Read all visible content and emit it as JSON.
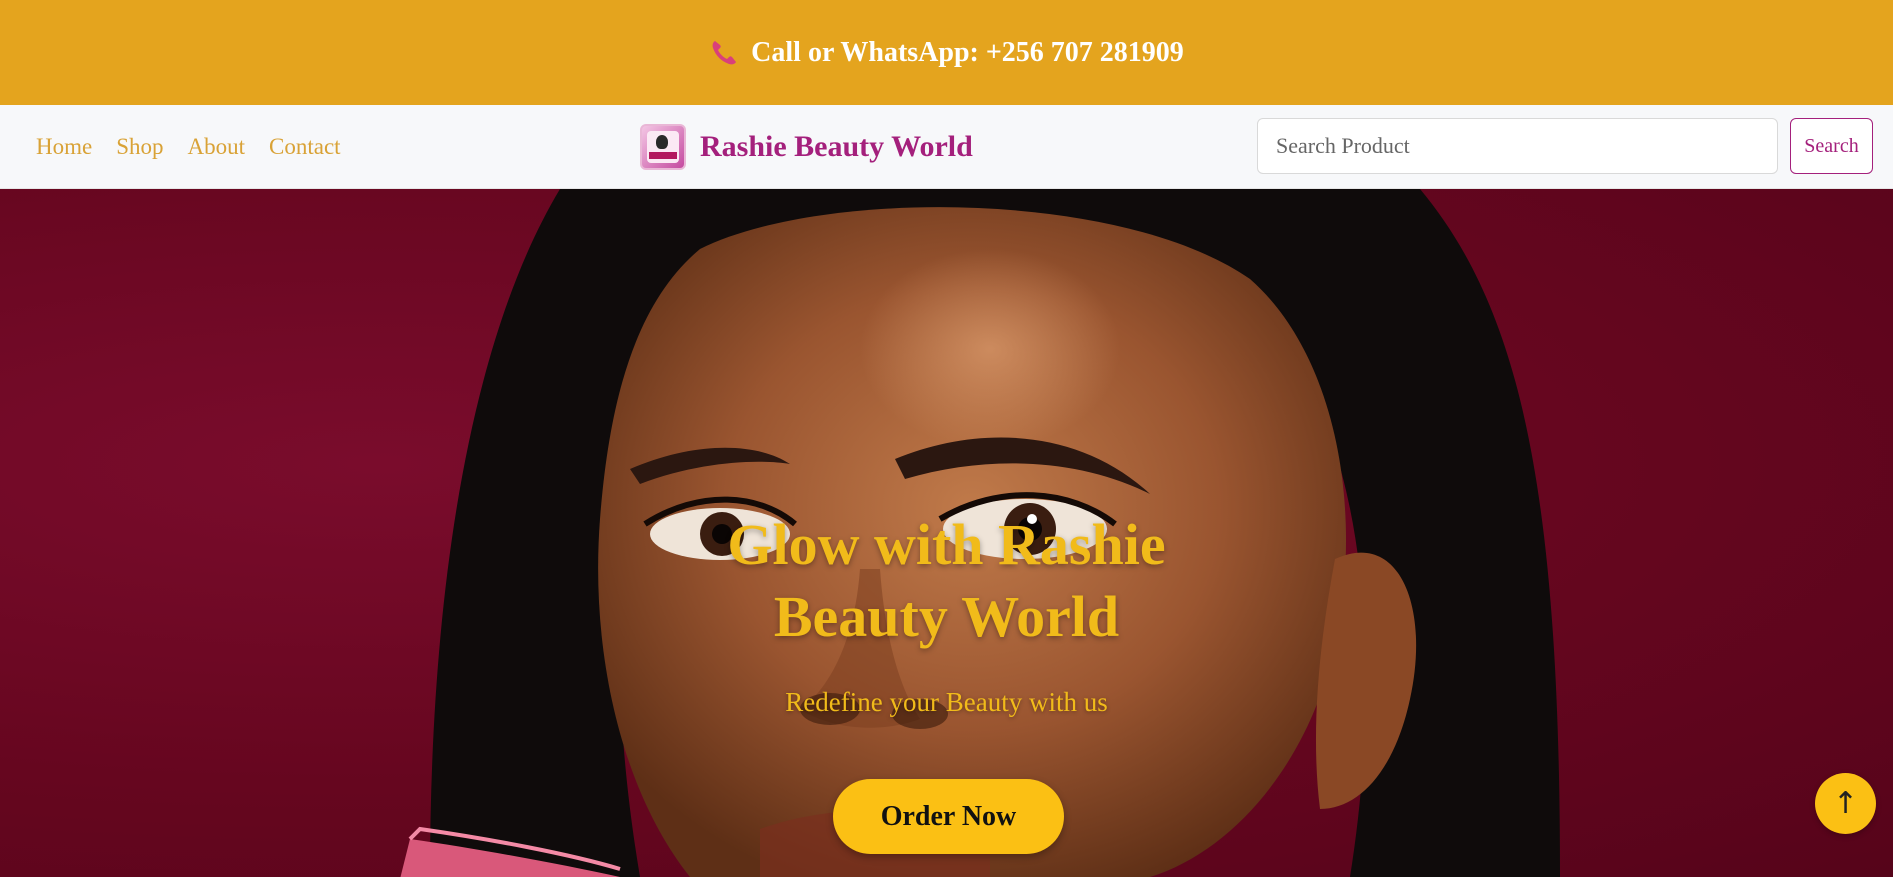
{
  "topbar": {
    "contact_text": "Call or WhatsApp: +256 707 281909",
    "icon": "phone-icon",
    "background": "#e4a41e"
  },
  "nav": {
    "links": [
      "Home",
      "Shop",
      "About",
      "Contact"
    ],
    "link_color": "#d9a236"
  },
  "brand": {
    "name": "Rashie Beauty World",
    "color": "#a4207c",
    "logo_icon": "brand-logo"
  },
  "search": {
    "placeholder": "Search Product",
    "value": "",
    "button_label": "Search"
  },
  "hero": {
    "title_line1": "Glow with Rashie",
    "title_line2": "Beauty World",
    "subtitle": "Redefine your Beauty with us",
    "cta_label": "Order Now",
    "accent": "#fbc014",
    "background": "#66061f"
  },
  "scroll_top": {
    "label": "↑"
  }
}
